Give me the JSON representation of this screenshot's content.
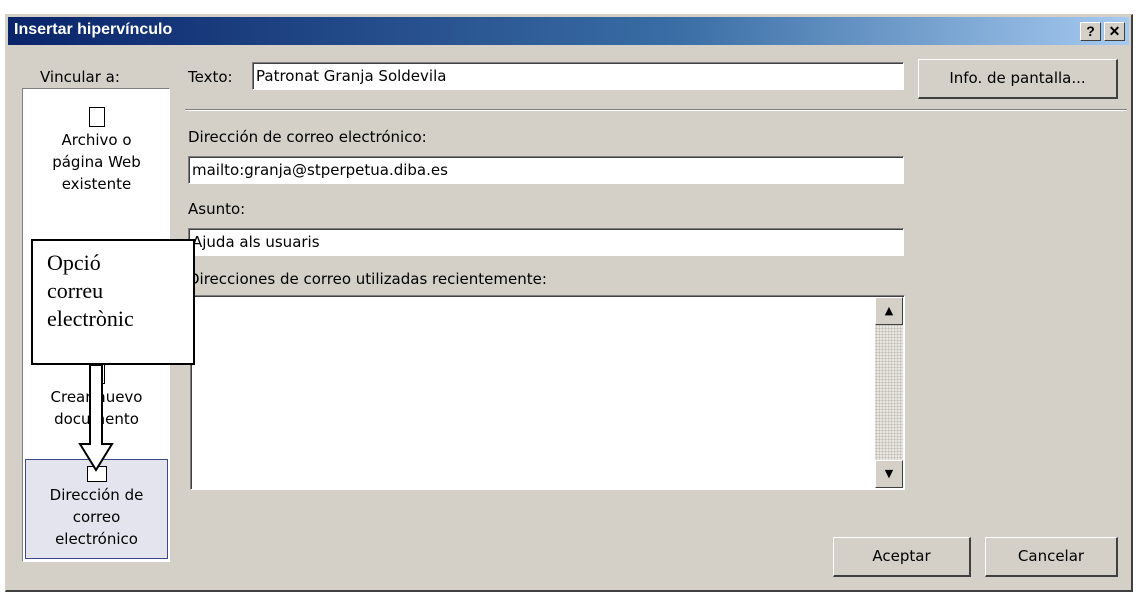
{
  "window": {
    "title": "Insertar hipervínculo",
    "help_glyph": "?",
    "close_glyph": "✕"
  },
  "link_to": {
    "label": "Vincular a:"
  },
  "sidebar": {
    "items": [
      {
        "line1": "Archivo o",
        "line2": "página Web",
        "line3": "existente",
        "icon": "web-page-icon"
      },
      {
        "line1": "Crear nuevo",
        "line2": "documento",
        "icon": "new-document-icon"
      },
      {
        "line1": "Dirección de",
        "line2": "correo",
        "line3": "electrónico",
        "icon": "email-envelope-icon"
      }
    ]
  },
  "text_field": {
    "label": "Texto:",
    "value": "Patronat Granja Soldevila"
  },
  "screen_tip_button": {
    "label": "Info. de pantalla..."
  },
  "email_address": {
    "label": "Dirección de correo electrónico:",
    "value": "mailto:granja@stperpetua.diba.es"
  },
  "subject": {
    "label": "Asunto:",
    "value": "Ajuda als usuaris"
  },
  "recent": {
    "label": "Direcciones de correo utilizadas recientemente:"
  },
  "scroll": {
    "up": "▲",
    "down": "▼"
  },
  "buttons": {
    "ok": "Aceptar",
    "cancel": "Cancelar"
  },
  "callout": {
    "line1": "Opció",
    "line2": "correu",
    "line3": "electrònic"
  },
  "colors": {
    "titlebar_start": "#0a246a",
    "face": "#d4d0c8",
    "selected_item": "#e4e4ee"
  }
}
